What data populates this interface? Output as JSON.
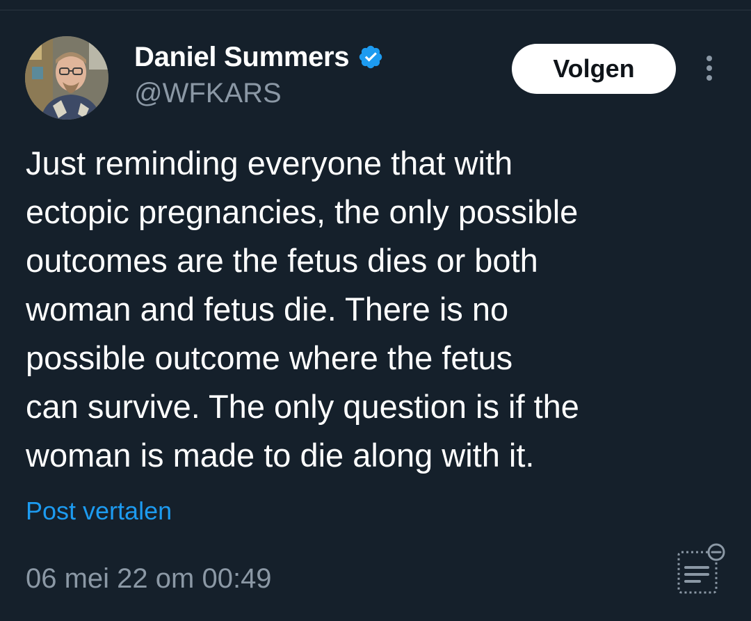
{
  "author": {
    "display_name": "Daniel Summers",
    "handle": "@WFKARS",
    "verified": true,
    "verified_color": "#1d9bf0"
  },
  "follow_button": {
    "label": "Volgen"
  },
  "tweet": {
    "text": "Just reminding everyone that with\nectopic pregnancies, the only possible\noutcomes are the fetus dies or both\nwoman and fetus die. There is no\npossible outcome where the fetus\ncan survive. The only question is if the\nwoman is made to die along with it.",
    "translate_label": "Post vertalen",
    "timestamp": "06 mei 22 om 00:49"
  },
  "icons": {
    "verified": "verified-badge-icon",
    "more": "more-vertical-icon",
    "reader": "reader-mode-icon"
  },
  "colors": {
    "background": "#15202b",
    "text": "#ffffff",
    "secondary_text": "#8b98a5",
    "link": "#1d9bf0",
    "button_bg": "#ffffff"
  }
}
